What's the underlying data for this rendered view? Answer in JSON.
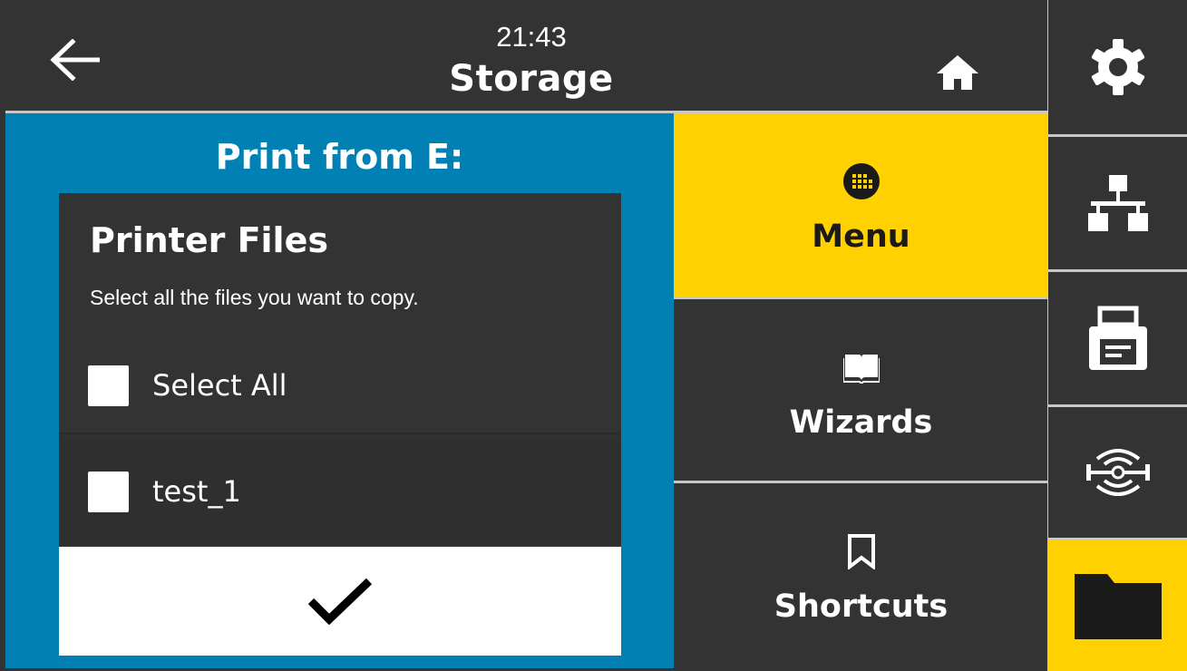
{
  "header": {
    "time": "21:43",
    "title": "Storage",
    "back_icon": "arrow-left-icon",
    "home_icon": "home-icon"
  },
  "panel": {
    "title": "Print from E:",
    "dialog": {
      "title": "Printer Files",
      "subtitle": "Select all the files you want to copy.",
      "select_all_label": "Select All",
      "files": [
        {
          "name": "test_1",
          "checked": false
        }
      ],
      "confirm_icon": "checkmark-icon"
    }
  },
  "nav": {
    "items": [
      {
        "label": "Menu",
        "icon": "grid-dots-icon",
        "active": true
      },
      {
        "label": "Wizards",
        "icon": "book-icon",
        "active": false
      },
      {
        "label": "Shortcuts",
        "icon": "bookmark-icon",
        "active": false
      }
    ]
  },
  "sidebar": {
    "items": [
      {
        "icon": "gear-icon"
      },
      {
        "icon": "network-icon"
      },
      {
        "icon": "printer-icon"
      },
      {
        "icon": "rfid-icon"
      },
      {
        "icon": "folder-icon",
        "active": true
      }
    ]
  },
  "colors": {
    "accent_yellow": "#ffd100",
    "panel_blue": "#0080b3",
    "background_dark": "#333333",
    "divider": "#c8c8c8"
  }
}
